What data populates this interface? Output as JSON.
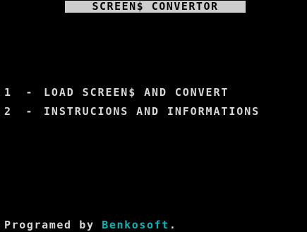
{
  "app": {
    "title": "SCREEN$ CONVERTOR"
  },
  "menu": {
    "items": [
      {
        "key": "1",
        "separator": "-",
        "label": "LOAD SCREEN$ AND CONVERT"
      },
      {
        "key": "2",
        "separator": "-",
        "label": "INSTRUCIONS AND INFORMATIONS"
      }
    ]
  },
  "footer": {
    "prefix": "Programed by ",
    "author": "Benkosoft",
    "suffix": "."
  },
  "colors": {
    "background": "#000000",
    "text": "#d7d7d7",
    "title_bar": "#cdcdcd",
    "author": "#00b7b7"
  }
}
